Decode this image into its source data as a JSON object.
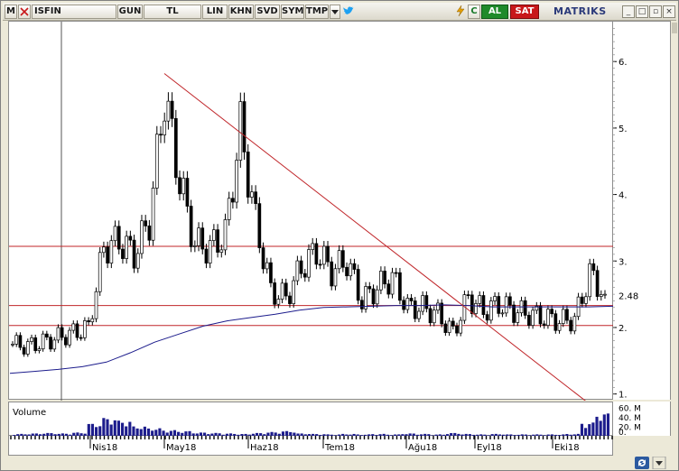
{
  "toolbar": {
    "menu_letter": "M",
    "symbol": "ISFIN",
    "buttons": [
      "GUN",
      "TL",
      "LIN",
      "KHN",
      "SVD",
      "SYM",
      "TMP"
    ],
    "twitter_icon": "twitter-icon",
    "bolt_icon": "lightning-icon",
    "refresh_label": "C",
    "buy_label": "AL",
    "sell_label": "SAT",
    "logo": "MATRIKS",
    "window_buttons": [
      "_",
      "□",
      "▫",
      "×"
    ]
  },
  "chart_data": {
    "type": "candlestick",
    "y_ticks": [
      "6.",
      "5.",
      "4.",
      "3.",
      "2.",
      "1."
    ],
    "y_tick_values": [
      6,
      5,
      4,
      3,
      2,
      1
    ],
    "ylim": [
      0.9,
      6.6
    ],
    "last_price": "2.48",
    "x_labels": [
      "Nis18",
      "May18",
      "Haz18",
      "Tem18",
      "Ağu18",
      "Eyl18",
      "Eki18"
    ],
    "horizontal_lines": [
      3.22,
      2.33,
      2.03
    ],
    "trend_line": {
      "from": {
        "date": "May18-start",
        "value": 5.82
      },
      "to": {
        "date": "Eki18-late",
        "value": 0.88
      }
    },
    "moving_average": [
      1.31,
      1.34,
      1.37,
      1.41,
      1.48,
      1.62,
      1.78,
      1.9,
      2.02,
      2.1,
      2.15,
      2.2,
      2.26,
      2.3,
      2.31,
      2.32,
      2.33,
      2.33,
      2.34,
      2.33,
      2.31,
      2.31,
      2.31,
      2.31,
      2.31,
      2.32
    ],
    "price_series": [
      1.75,
      1.72,
      1.78,
      1.85,
      1.92,
      2.0,
      3.2,
      3.3,
      3.1,
      3.6,
      5.5,
      4.2,
      3.25,
      3.2,
      3.4,
      5.0,
      3.6,
      2.55,
      2.45,
      2.9,
      3.15,
      2.85,
      3.0,
      2.4,
      2.6,
      2.75,
      2.3,
      2.3,
      2.2,
      1.92,
      2.45,
      2.25,
      2.35,
      2.25,
      2.2,
      2.15,
      2.1,
      2.12,
      2.8,
      2.5
    ],
    "volume_label": "Volume",
    "volume_ticks": [
      "60. M",
      "40. M",
      "20. M",
      "0."
    ],
    "volume_series": [
      6,
      7,
      8,
      7,
      9,
      28,
      40,
      34,
      22,
      18,
      14,
      12,
      9,
      8,
      7,
      6,
      8,
      10,
      12,
      7,
      6,
      5,
      6,
      5,
      6,
      5,
      7,
      6,
      5,
      8,
      6,
      5,
      6,
      5,
      5,
      5,
      5,
      6,
      30,
      50
    ]
  }
}
